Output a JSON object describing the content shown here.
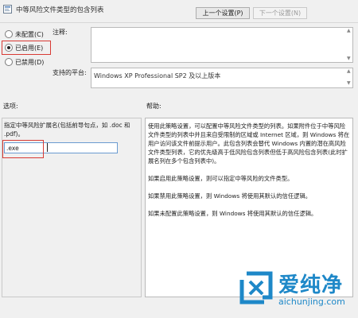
{
  "window": {
    "title": "中等风险文件类型的包含列表"
  },
  "nav": {
    "prev_label": "上一个设置(P)",
    "next_label": "下一个设置(N)"
  },
  "state": {
    "options": [
      {
        "label": "未配置(C)",
        "selected": false
      },
      {
        "label": "已启用(E)",
        "selected": true
      },
      {
        "label": "已禁用(D)",
        "selected": false
      }
    ]
  },
  "comment": {
    "label": "注释:",
    "value": ""
  },
  "supported": {
    "label": "支持的平台:",
    "value": "Windows XP Professional SP2 及以上版本"
  },
  "options_panel": {
    "header": "选项:",
    "description": "指定中等风险扩展名(包括前导句点，如 .doc 和 .pdf)。",
    "extension_value": ".exe"
  },
  "help_panel": {
    "header": "帮助:",
    "paragraphs": [
      "使用此策略设置，可以配置中等风险文件类型的列表。如果附件位于中等风险文件类型的列表中并且来自受限制的区域或 Internet 区域，则 Windows 将在用户访问该文件前提示用户。此包含列表会替代 Windows 内置的潜在高风险文件类型列表，它的优先级高于低风险包含列表但低于高风险包含列表(此时扩展名列在多个包含列表中)。",
      "如果启用此策略设置，则可以指定中等风险的文件类型。",
      "如果禁用此策略设置，则 Windows 将使用其默认的信任逻辑。",
      "如果未配置此策略设置，则 Windows 将使用其默认的信任逻辑。"
    ]
  },
  "watermark": {
    "brand": "爱纯净",
    "url": "aichunjing.com"
  },
  "colors": {
    "highlight": "#d83a34",
    "watermark_blue": "#1e88c8"
  },
  "icons": {
    "title": "policy-settings-icon",
    "watermark": "pure-logo-icon"
  }
}
